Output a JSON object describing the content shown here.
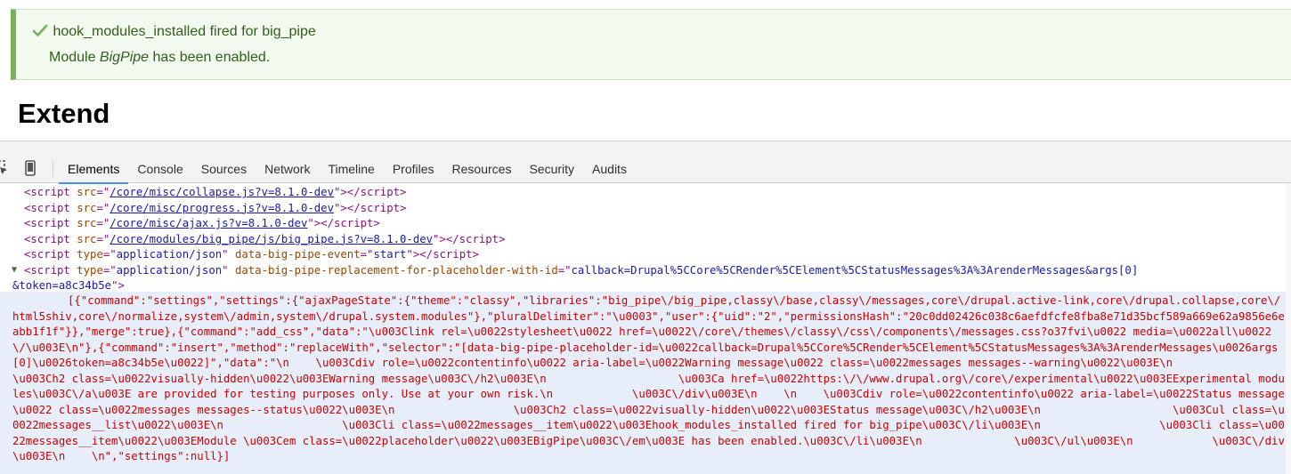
{
  "status": {
    "line1": "hook_modules_installed fired for big_pipe",
    "line2_prefix": "Module ",
    "line2_module": "BigPipe",
    "line2_suffix": " has been enabled."
  },
  "page": {
    "title": "Extend"
  },
  "devtools": {
    "tabs": [
      "Elements",
      "Console",
      "Sources",
      "Network",
      "Timeline",
      "Profiles",
      "Resources",
      "Security",
      "Audits"
    ],
    "active_tab": "Elements",
    "scripts": [
      {
        "src": "/core/misc/collapse.js?v=8.1.0-dev"
      },
      {
        "src": "/core/misc/progress.js?v=8.1.0-dev"
      },
      {
        "src": "/core/misc/ajax.js?v=8.1.0-dev"
      },
      {
        "src": "/core/modules/big_pipe/js/big_pipe.js?v=8.1.0-dev"
      }
    ],
    "event_script": {
      "type": "application/json",
      "attr": "data-big-pipe-event",
      "value": "start"
    },
    "replacement_script": {
      "type": "application/json",
      "attr": "data-big-pipe-replacement-for-placeholder-with-id",
      "value_line1": "callback=Drupal%5CCore%5CRender%5CElement%5CStatusMessages%3A%3ArenderMessages&args[0]",
      "value_line2": "&token=a8c34b5e"
    },
    "json_content": "[{\"command\":\"settings\",\"settings\":{\"ajaxPageState\":{\"theme\":\"classy\",\"libraries\":\"big_pipe\\/big_pipe,classy\\/base,classy\\/messages,core\\/drupal.active-link,core\\/drupal.collapse,core\\/html5shiv,core\\/normalize,system\\/admin,system\\/drupal.system.modules\"},\"pluralDelimiter\":\"\\u0003\",\"user\":{\"uid\":\"2\",\"permissionsHash\":\"20c0dd02426c038c6aefdfcfe8fba8e71d35bcf589a669e62a9856e6eabb1f1f\"}},\"merge\":true},{\"command\":\"add_css\",\"data\":\"\\u003Clink rel=\\u0022stylesheet\\u0022 href=\\u0022\\/core\\/themes\\/classy\\/css\\/components\\/messages.css?o37fvi\\u0022 media=\\u0022all\\u0022 \\/\\u003E\\n\"},{\"command\":\"insert\",\"method\":\"replaceWith\",\"selector\":\"[data-big-pipe-placeholder-id=\\u0022callback=Drupal%5CCore%5CRender%5CElement%5CStatusMessages%3A%3ArenderMessages\\u0026args[0]\\u0026token=a8c34b5e\\u0022]\",\"data\":\"\\n    \\u003Cdiv role=\\u0022contentinfo\\u0022 aria-label=\\u0022Warning message\\u0022 class=\\u0022messages messages--warning\\u0022\\u003E\\n                  \\u003Ch2 class=\\u0022visually-hidden\\u0022\\u003EWarning message\\u003C\\/h2\\u003E\\n                    \\u003Ca href=\\u0022https:\\/\\/www.drupal.org\\/core\\/experimental\\u0022\\u003EExperimental modules\\u003C\\/a\\u003E are provided for testing purposes only. Use at your own risk.\\n            \\u003C\\/div\\u003E\\n    \\n    \\u003Cdiv role=\\u0022contentinfo\\u0022 aria-label=\\u0022Status message\\u0022 class=\\u0022messages messages--status\\u0022\\u003E\\n                  \\u003Ch2 class=\\u0022visually-hidden\\u0022\\u003EStatus message\\u003C\\/h2\\u003E\\n                    \\u003Cul class=\\u0022messages__list\\u0022\\u003E\\n                  \\u003Cli class=\\u0022messages__item\\u0022\\u003Ehook_modules_installed fired for big_pipe\\u003C\\/li\\u003E\\n                  \\u003Cli class=\\u0022messages__item\\u0022\\u003EModule \\u003Cem class=\\u0022placeholder\\u0022\\u003EBigPipe\\u003C\\/em\\u003E has been enabled.\\u003C\\/li\\u003E\\n              \\u003C\\/ul\\u003E\\n            \\u003C\\/div\\u003E\\n    \\n\",\"settings\":null}]",
    "colors": {
      "accent": "#4a8af4",
      "status_border": "#77b259",
      "json_text": "#c80000"
    }
  }
}
